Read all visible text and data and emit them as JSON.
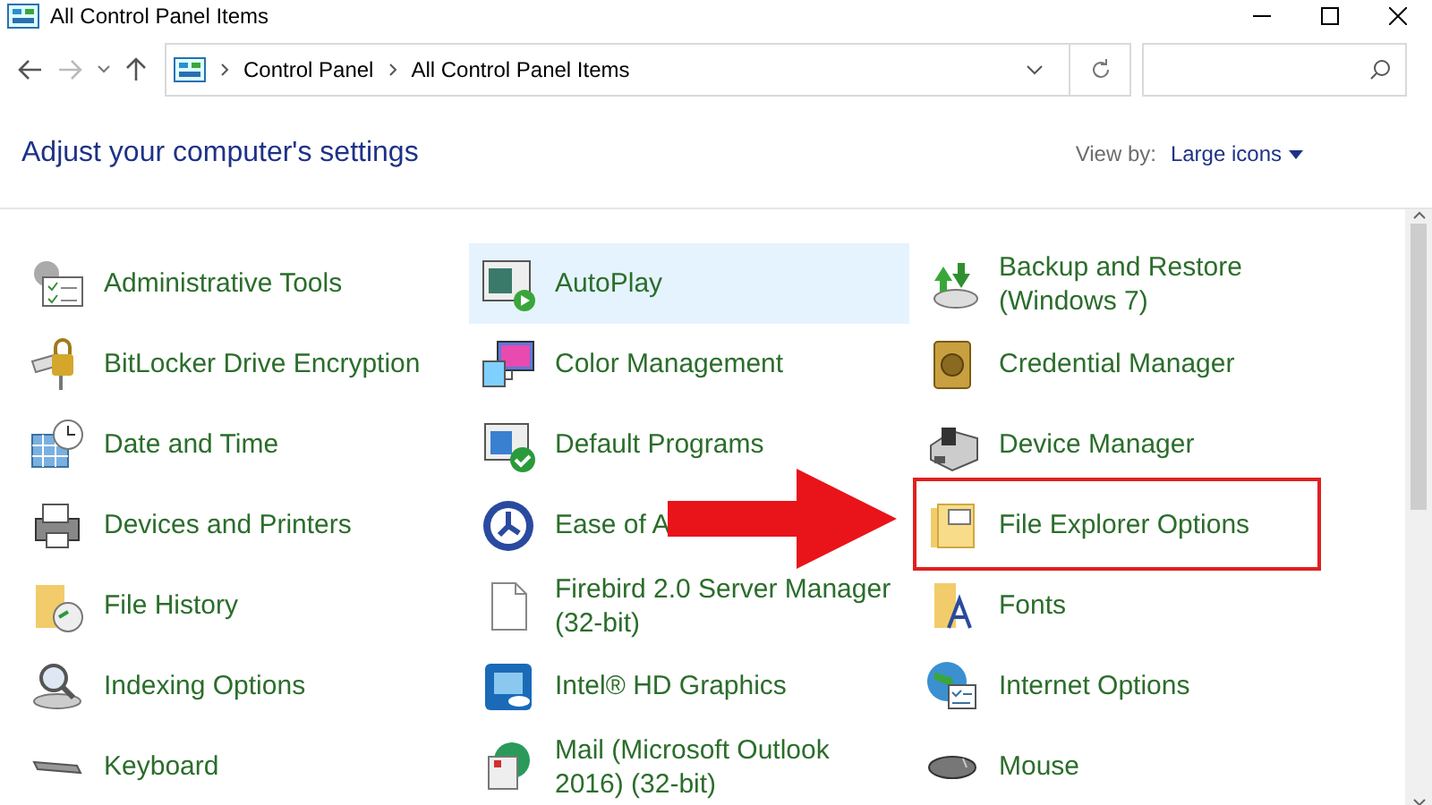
{
  "window": {
    "title": "All Control Panel Items"
  },
  "address_bar": {
    "path": [
      "Control Panel",
      "All Control Panel Items"
    ]
  },
  "heading": "Adjust your computer's settings",
  "view_by": {
    "label": "View by:",
    "value": "Large icons"
  },
  "items": [
    {
      "label": "Administrative Tools",
      "selected": false,
      "boxed": false
    },
    {
      "label": "AutoPlay",
      "selected": true,
      "boxed": false
    },
    {
      "label": "Backup and Restore (Windows 7)",
      "selected": false,
      "boxed": false
    },
    {
      "label": "BitLocker Drive Encryption",
      "selected": false,
      "boxed": false
    },
    {
      "label": "Color Management",
      "selected": false,
      "boxed": false
    },
    {
      "label": "Credential Manager",
      "selected": false,
      "boxed": false
    },
    {
      "label": "Date and Time",
      "selected": false,
      "boxed": false
    },
    {
      "label": "Default Programs",
      "selected": false,
      "boxed": false
    },
    {
      "label": "Device Manager",
      "selected": false,
      "boxed": false
    },
    {
      "label": "Devices and Printers",
      "selected": false,
      "boxed": false
    },
    {
      "label": "Ease of A",
      "selected": false,
      "boxed": false
    },
    {
      "label": "File Explorer Options",
      "selected": false,
      "boxed": true
    },
    {
      "label": "File History",
      "selected": false,
      "boxed": false
    },
    {
      "label": "Firebird 2.0 Server Manager (32-bit)",
      "selected": false,
      "boxed": false
    },
    {
      "label": "Fonts",
      "selected": false,
      "boxed": false
    },
    {
      "label": "Indexing Options",
      "selected": false,
      "boxed": false
    },
    {
      "label": "Intel® HD Graphics",
      "selected": false,
      "boxed": false
    },
    {
      "label": "Internet Options",
      "selected": false,
      "boxed": false
    },
    {
      "label": "Keyboard",
      "selected": false,
      "boxed": false
    },
    {
      "label": "Mail (Microsoft Outlook 2016) (32-bit)",
      "selected": false,
      "boxed": false
    },
    {
      "label": "Mouse",
      "selected": false,
      "boxed": false
    }
  ],
  "annotation_arrow": true
}
